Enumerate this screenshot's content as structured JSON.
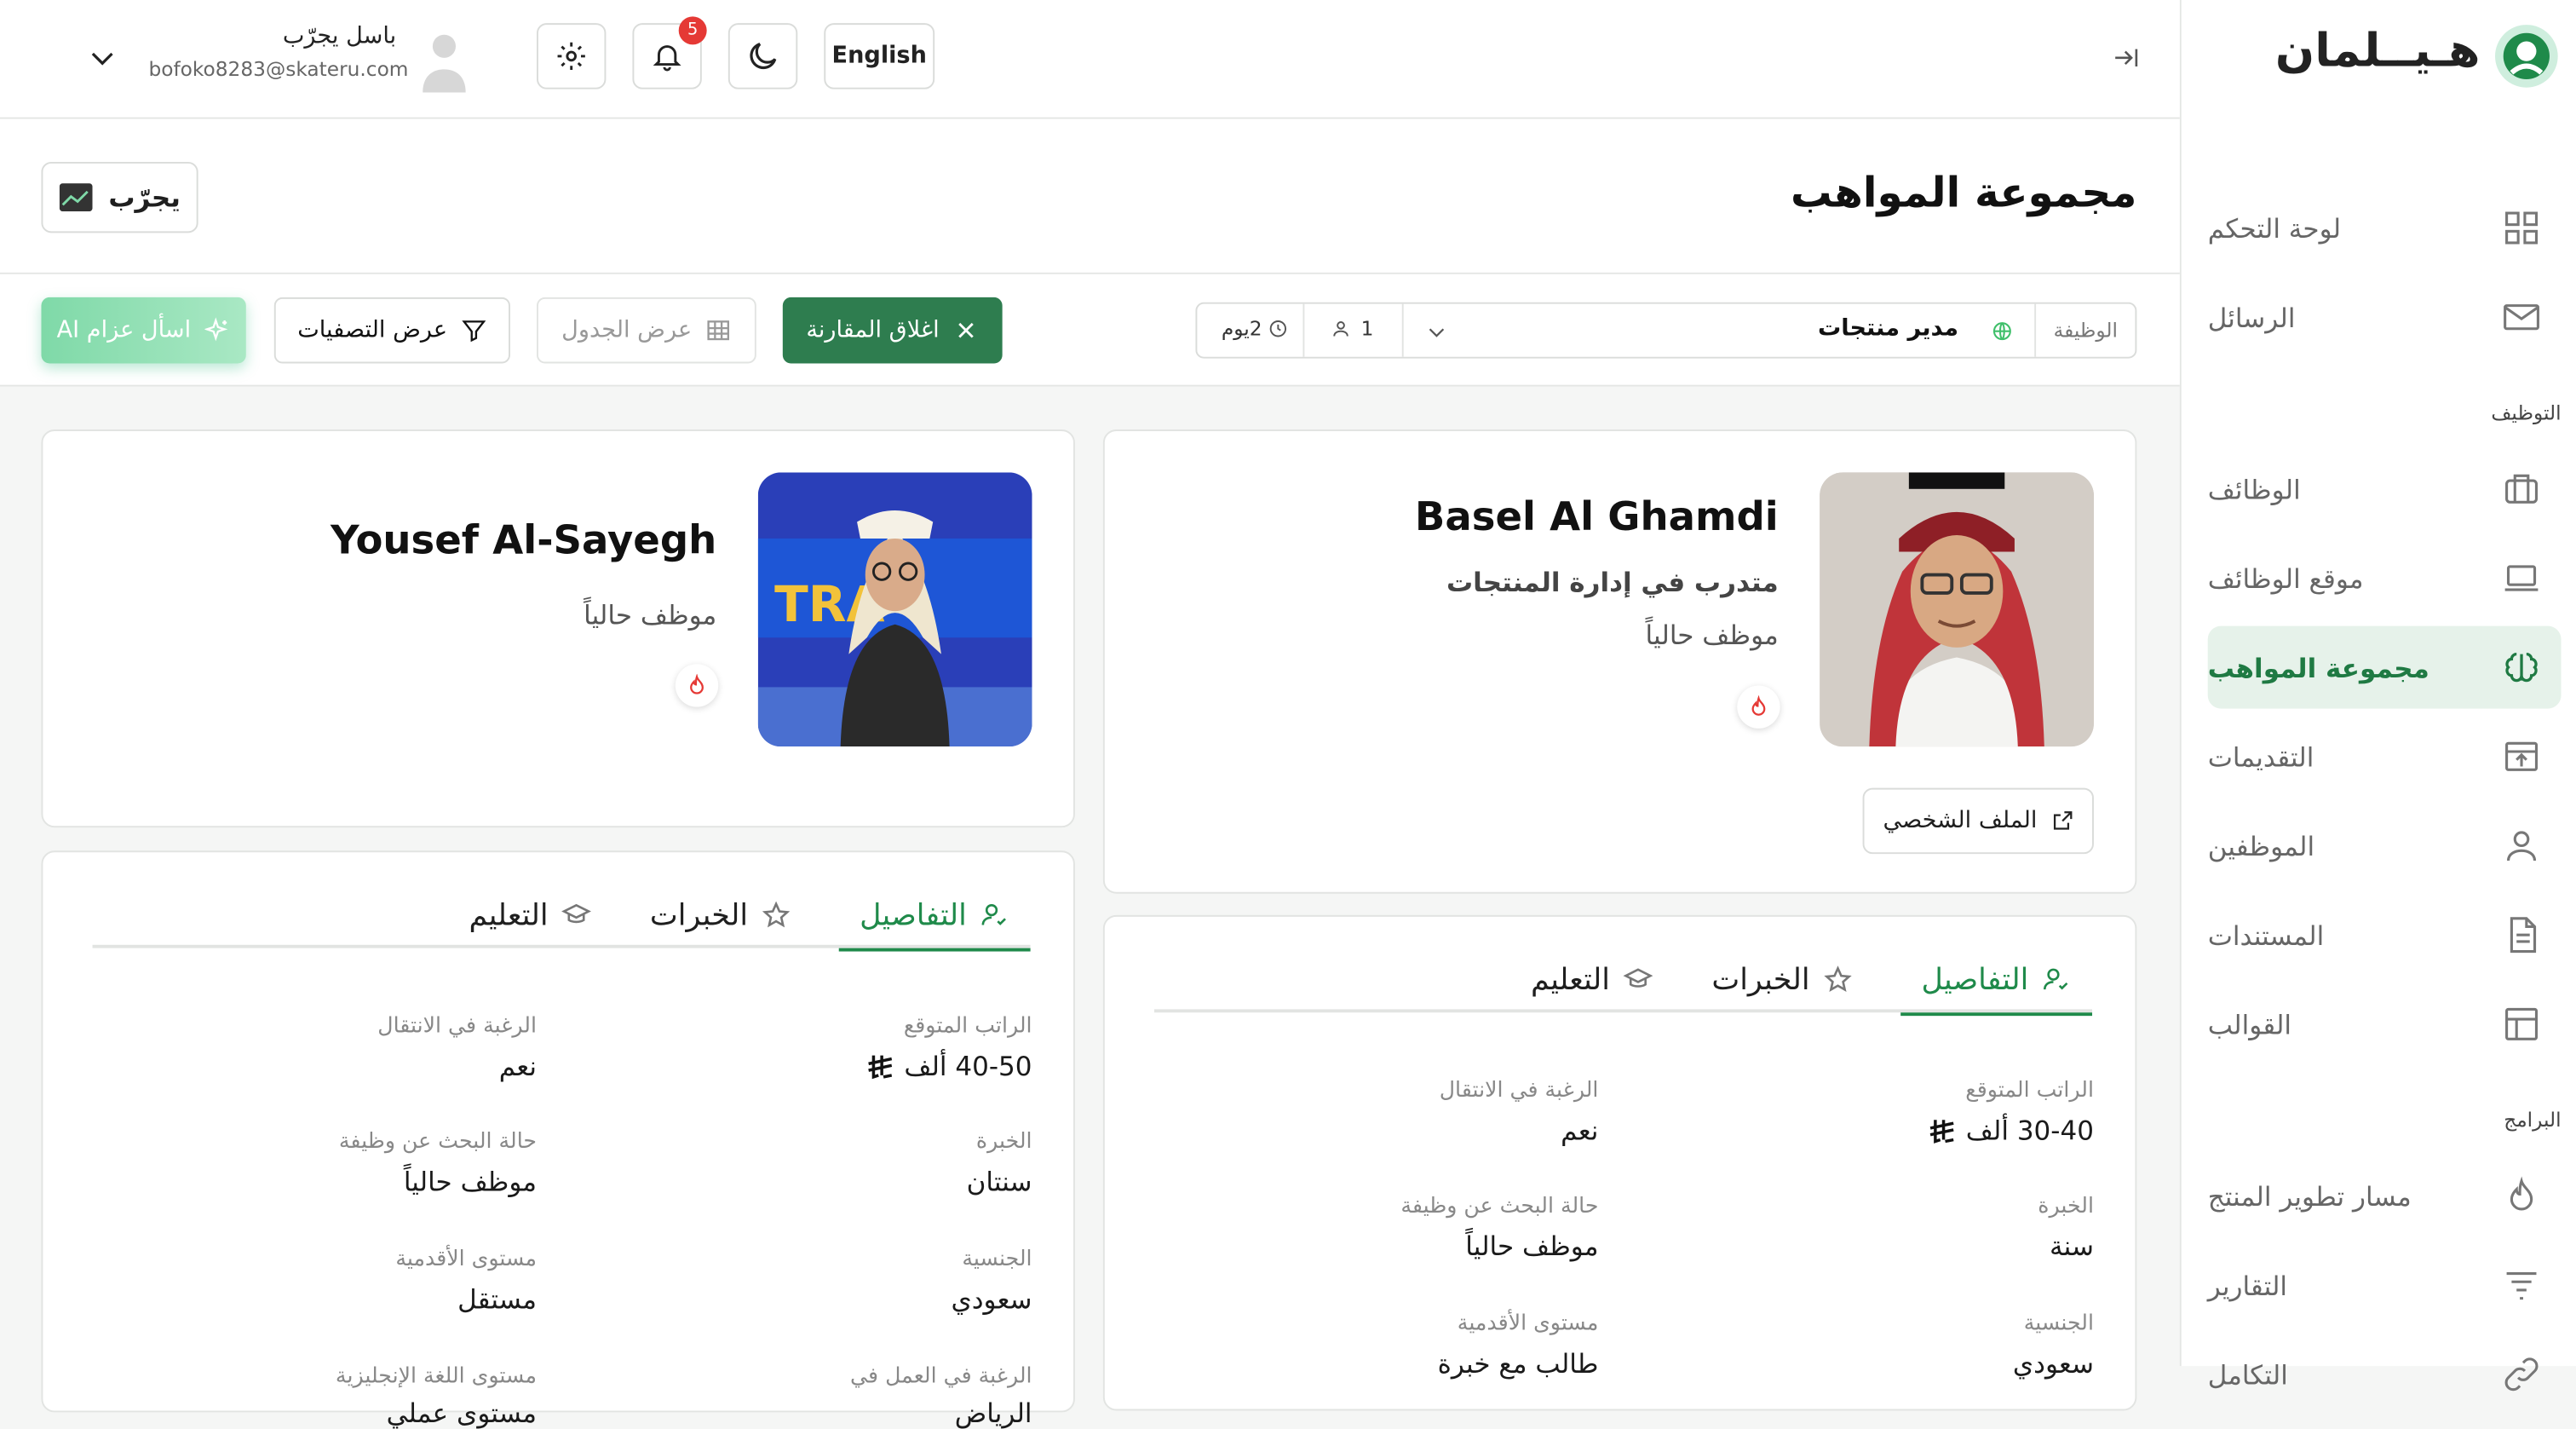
{
  "brand": {
    "name": "هـيــلمان"
  },
  "sidebar": {
    "items": [
      {
        "label": "لوحة التحكم",
        "icon": "dashboard-icon"
      },
      {
        "label": "الرسائل",
        "icon": "mail-icon"
      }
    ],
    "section_hiring": "التوظيف",
    "hiring_items": [
      {
        "label": "الوظائف",
        "icon": "briefcase-icon"
      },
      {
        "label": "موقع الوظائف",
        "icon": "laptop-icon"
      },
      {
        "label": "مجموعة المواهب",
        "icon": "brain-icon",
        "active": true
      },
      {
        "label": "التقديمات",
        "icon": "inbox-upload-icon"
      },
      {
        "label": "الموظفين",
        "icon": "user-icon"
      },
      {
        "label": "المستندات",
        "icon": "document-icon"
      },
      {
        "label": "القوالب",
        "icon": "template-icon"
      }
    ],
    "section_programs": "البرامج",
    "program_items": [
      {
        "label": "مسار تطوير المنتج",
        "icon": "flame-icon"
      },
      {
        "label": "التقارير",
        "icon": "report-icon"
      },
      {
        "label": "التكامل",
        "icon": "link-icon"
      }
    ]
  },
  "header": {
    "user_name": "باسل يجرّب",
    "user_email": "bofoko8283@skateru.com",
    "notification_count": "5",
    "language": "English"
  },
  "page": {
    "title": "مجموعة المواهب",
    "company_button": "يجرّب"
  },
  "filters": {
    "job_label": "الوظيفة",
    "job_value": "مدير منتجات",
    "count": "1",
    "age": "2يوم",
    "close_compare": "اغلاق المقارنة",
    "table_view": "عرض الجدول",
    "show_filters": "عرض التصفيات",
    "ask_ai": "اسأل عزام AI"
  },
  "candidates": [
    {
      "name": "Basel Al Ghamdi",
      "title": "متدرب في إدارة المنتجات",
      "status": "موظف حالياً",
      "profile_button": "الملف الشخصي",
      "tabs": [
        "التفاصيل",
        "الخبرات",
        "التعليم"
      ],
      "fields": [
        {
          "label": "الراتب المتوقع",
          "value": "30-40 ألف"
        },
        {
          "label": "الرغبة في الانتقال",
          "value": "نعم"
        },
        {
          "label": "الخبرة",
          "value": "سنة"
        },
        {
          "label": "حالة البحث عن وظيفة",
          "value": "موظف حالياً"
        },
        {
          "label": "الجنسية",
          "value": "سعودي"
        },
        {
          "label": "مستوى الأقدمية",
          "value": "طالب مع خبرة"
        }
      ]
    },
    {
      "name": "Yousef Al-Sayegh",
      "status": "موظف حالياً",
      "tabs": [
        "التفاصيل",
        "الخبرات",
        "التعليم"
      ],
      "fields": [
        {
          "label": "الراتب المتوقع",
          "value": "40-50 ألف"
        },
        {
          "label": "الرغبة في الانتقال",
          "value": "نعم"
        },
        {
          "label": "الخبرة",
          "value": "سنتان"
        },
        {
          "label": "حالة البحث عن وظيفة",
          "value": "موظف حالياً"
        },
        {
          "label": "الجنسية",
          "value": "سعودي"
        },
        {
          "label": "مستوى الأقدمية",
          "value": "مستقل"
        },
        {
          "label": "الرغبة في العمل في",
          "value": "الرياض"
        },
        {
          "label": "مستوى اللغة الإنجليزية",
          "value": "مستوى عملي"
        }
      ]
    }
  ],
  "colors": {
    "accent": "#2e7d4f",
    "active_bg": "#e6f2ea",
    "ai_gradient_start": "#7fd9a8",
    "ai_gradient_end": "#3fbf8a",
    "badge": "#e53935"
  }
}
